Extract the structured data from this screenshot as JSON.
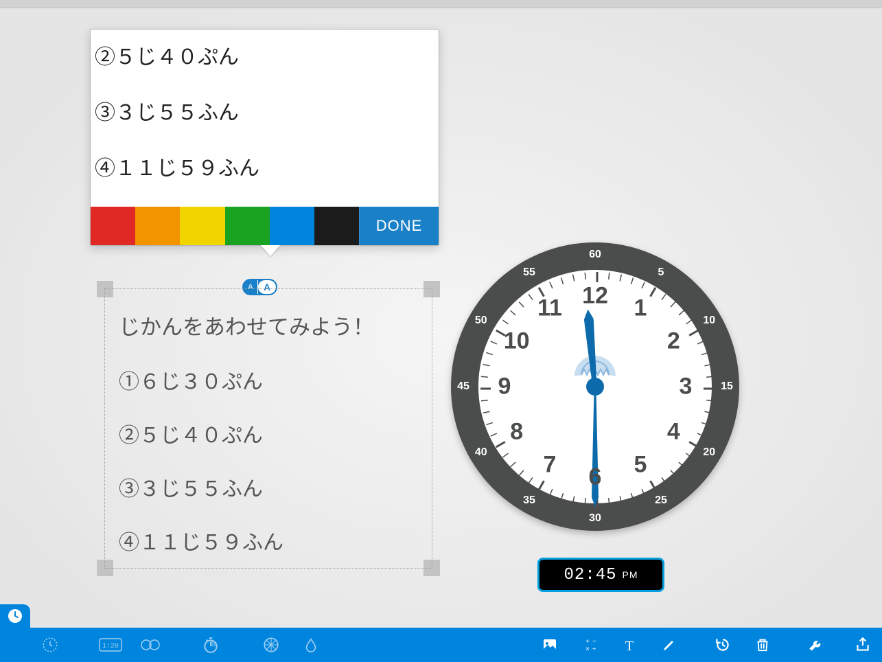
{
  "editor": {
    "lines": [
      "②５じ４０ぷん",
      "③３じ５５ふん",
      "④１１じ５９ふん"
    ],
    "done_label": "DONE",
    "colors": [
      "#e02824",
      "#f29300",
      "#f2d400",
      "#1aa321",
      "#0085de",
      "#1b1b1b"
    ]
  },
  "text_block": {
    "title": "じかんをあわせてみよう！",
    "lines": [
      "①６じ３０ぷん",
      "②５じ４０ぷん",
      "③３じ５５ふん",
      "④１１じ５９ふん"
    ],
    "size_small": "A",
    "size_large": "A"
  },
  "clock": {
    "outer_numbers": [
      "60",
      "5",
      "10",
      "15",
      "20",
      "25",
      "30",
      "35",
      "40",
      "45",
      "50",
      "55"
    ],
    "inner_numbers": [
      "12",
      "1",
      "2",
      "3",
      "4",
      "5",
      "6",
      "7",
      "8",
      "9",
      "10",
      "11"
    ],
    "hour_hand_angle_deg": -5,
    "minute_hand_angle_deg": 180
  },
  "digital": {
    "time": "02:45",
    "ampm": "PM"
  },
  "toolbar": {
    "left": [
      "analog-clock",
      "analog-empty",
      "digital-small",
      "elapsed",
      "stopwatch",
      "fraction-circle",
      "drop"
    ],
    "right": [
      "image",
      "operations",
      "text",
      "pencil",
      "history",
      "trash",
      "wrench",
      "share"
    ]
  }
}
